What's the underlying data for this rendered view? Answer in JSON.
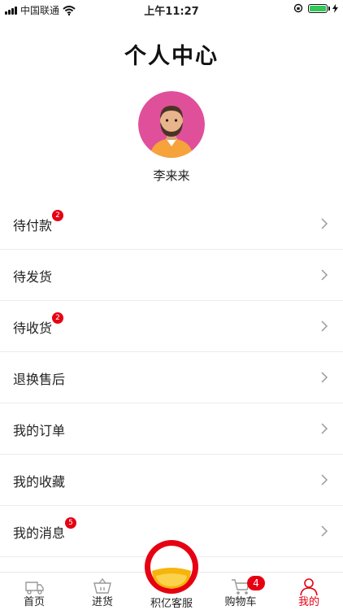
{
  "status": {
    "carrier": "中国联通",
    "time": "上午11:27"
  },
  "page": {
    "title": "个人中心",
    "username": "李来来"
  },
  "menu": [
    {
      "label": "待付款",
      "badge": "2"
    },
    {
      "label": "待发货",
      "badge": null
    },
    {
      "label": "待收货",
      "badge": "2"
    },
    {
      "label": "退换售后",
      "badge": null
    },
    {
      "label": "我的订单",
      "badge": null
    },
    {
      "label": "我的收藏",
      "badge": null
    },
    {
      "label": "我的消息",
      "badge": "5"
    }
  ],
  "tabbar": {
    "home": "首页",
    "stock": "进货",
    "service": "积亿客服",
    "cart": "购物车",
    "cart_badge": "4",
    "mine": "我的"
  },
  "colors": {
    "accent": "#e60012",
    "avatar_bg": "#e0509a",
    "shirt": "#f5a33a"
  }
}
